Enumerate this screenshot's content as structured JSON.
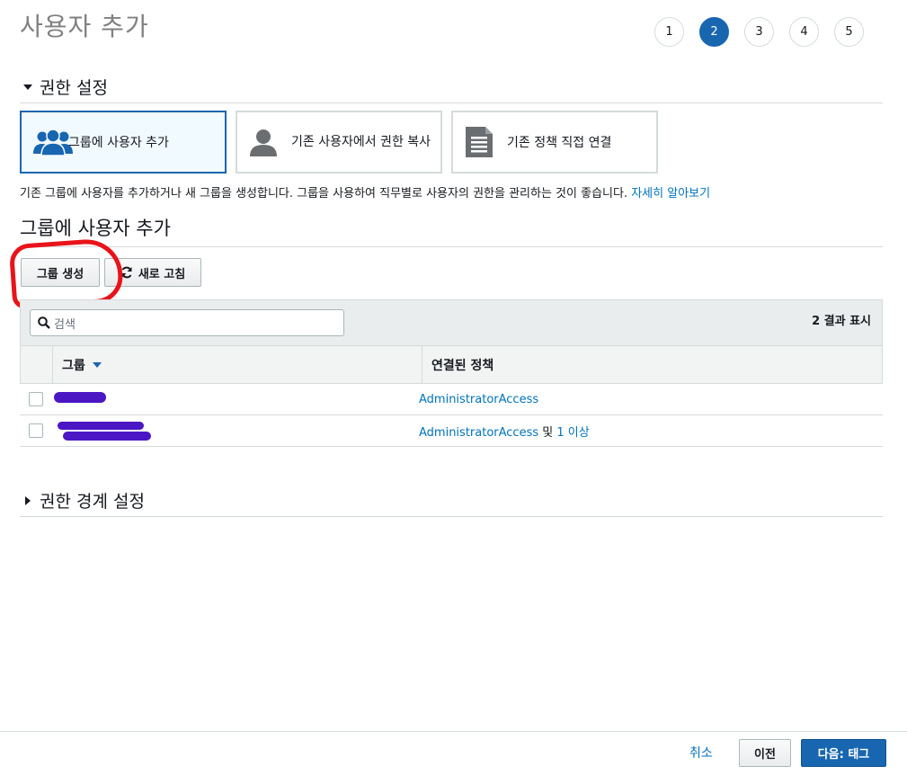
{
  "page": {
    "title": "사용자 추가"
  },
  "steps": [
    "1",
    "2",
    "3",
    "4",
    "5"
  ],
  "active_step": "2",
  "permissions": {
    "section_title": "권한 설정",
    "options": [
      {
        "label": "그룹에 사용자 추가",
        "icon": "users-group-icon",
        "selected": true
      },
      {
        "label": "기존 사용자에서 권한 복사",
        "icon": "user-icon",
        "selected": false
      },
      {
        "label": "기존 정책 직접 연결",
        "icon": "document-icon",
        "selected": false
      }
    ],
    "description": "기존 그룹에 사용자를 추가하거나 새 그룹을 생성합니다. 그룹을 사용하여 직무별로 사용자의 권한을 관리하는 것이 좋습니다.",
    "learn_more": "자세히 알아보기"
  },
  "group_section": {
    "title": "그룹에 사용자 추가",
    "create_group": "그룹 생성",
    "refresh": "새로 고침",
    "search_placeholder": "검색",
    "result_count": "2 결과 표시",
    "columns": {
      "group": "그룹",
      "policies": "연결된 정책"
    },
    "rows": [
      {
        "group": "",
        "policy": "AdministratorAccess",
        "extra": ""
      },
      {
        "group": "",
        "policy": "AdministratorAccess",
        "extra_connector": "및",
        "extra": "1 이상"
      }
    ]
  },
  "boundary": {
    "title": "권한 경계 설정"
  },
  "footer": {
    "cancel": "취소",
    "previous": "이전",
    "next": "다음: 태그"
  },
  "colors": {
    "accent": "#1866b0",
    "link": "#0073bb",
    "annotation": "#e8141a",
    "redaction": "#4b16c4"
  }
}
